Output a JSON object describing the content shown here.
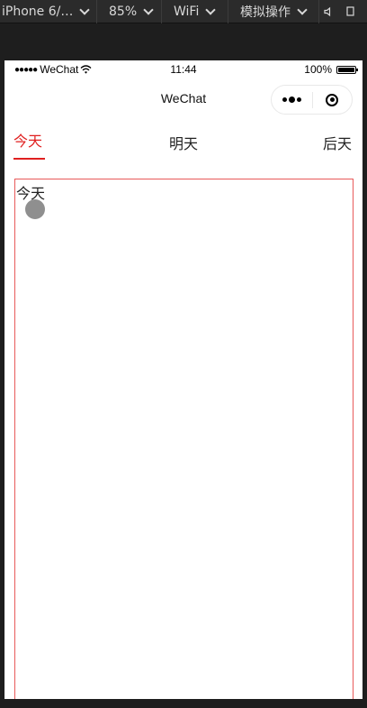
{
  "devtools": {
    "device": "iPhone 6/…",
    "zoom": "85%",
    "network": "WiFi",
    "simulate": "模拟操作"
  },
  "statusbar": {
    "carrier": "WeChat",
    "time": "11:44",
    "battery": "100%"
  },
  "navbar": {
    "title": "WeChat"
  },
  "tabs": [
    {
      "label": "今天",
      "active": true
    },
    {
      "label": "明天",
      "active": false
    },
    {
      "label": "后天",
      "active": false
    }
  ],
  "content": {
    "label": "今天"
  },
  "colors": {
    "accent": "#e02020",
    "content_border": "#e85a5a",
    "avatar": "#8f8f8f"
  }
}
